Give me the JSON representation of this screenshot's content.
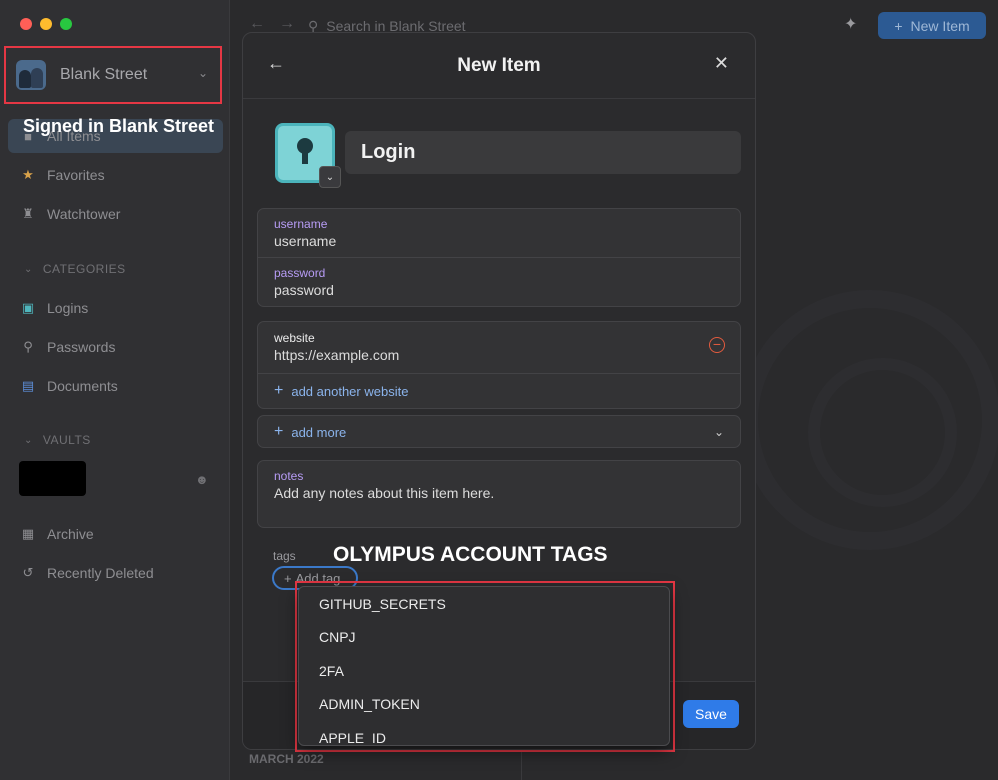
{
  "sidebar": {
    "account_name": "Blank Street",
    "items": [
      {
        "label": "All Items",
        "icon": "all-items-icon"
      },
      {
        "label": "Favorites",
        "icon": "star-icon"
      },
      {
        "label": "Watchtower",
        "icon": "watchtower-icon"
      }
    ],
    "categories_label": "CATEGORIES",
    "categories": [
      {
        "label": "Logins",
        "icon": "login-icon"
      },
      {
        "label": "Passwords",
        "icon": "key-icon"
      },
      {
        "label": "Documents",
        "icon": "document-icon"
      }
    ],
    "vaults_label": "VAULTS",
    "archive_label": "Archive",
    "recently_deleted_label": "Recently Deleted"
  },
  "toolbar": {
    "search_placeholder": "Search in Blank Street",
    "new_item_label": "New Item"
  },
  "list": {
    "month_label": "MARCH 2022"
  },
  "modal": {
    "title": "New Item",
    "item_title": "Login",
    "credentials": [
      {
        "label": "username",
        "value": "username"
      },
      {
        "label": "password",
        "value": "password"
      }
    ],
    "website": {
      "label": "website",
      "value": "https://example.com"
    },
    "add_website_label": "add another website",
    "add_more_label": "add more",
    "notes": {
      "label": "notes",
      "value": "Add any notes about this item here."
    },
    "tags_label": "tags",
    "add_tag_label": "Add tag",
    "save_label": "Save"
  },
  "tag_menu": {
    "options": [
      "GITHUB_SECRETS",
      "CNPJ",
      "2FA",
      "ADMIN_TOKEN",
      "APPLE_ID"
    ]
  },
  "annotations": {
    "signed_in": "Signed in Blank Street",
    "tags_heading": "OLYMPUS ACCOUNT TAGS"
  },
  "colors": {
    "accent": "#2f7be8",
    "highlight": "#e53744",
    "field_label": "#b79cf5",
    "link": "#8bb4ec"
  }
}
